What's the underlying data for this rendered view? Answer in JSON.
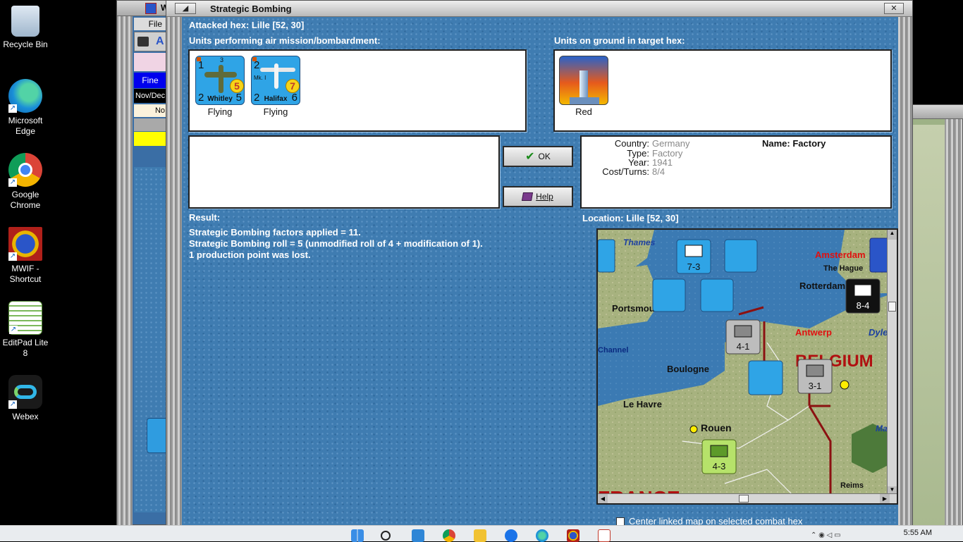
{
  "desktop": {
    "icons": [
      {
        "label": "Recycle Bin",
        "icon": "recycle-bin-icon"
      },
      {
        "label": "Microsoft Edge",
        "icon": "edge-icon"
      },
      {
        "label": "Google Chrome",
        "icon": "chrome-icon"
      },
      {
        "label": "MWIF - Shortcut",
        "icon": "mwif-icon"
      },
      {
        "label": "EditPad Lite 8",
        "icon": "editpad-icon"
      },
      {
        "label": "Webex",
        "icon": "webex-icon"
      }
    ]
  },
  "bg_window": {
    "title": "W",
    "menu_file": "File",
    "weather": "Fine",
    "turn": "Nov/Dec",
    "no": "No"
  },
  "dialog": {
    "title": "Strategic Bombing",
    "attacked_hex": "Attacked hex: Lille  [52, 30]",
    "air_units_label": "Units performing air mission/bombardment:",
    "ground_units_label": "Units on ground in target hex:",
    "air_units": [
      {
        "name": "Whitley",
        "status": "Flying",
        "top_left": "1",
        "top_mid": "3",
        "bottom_left": "2",
        "bottom_right": "5",
        "factor": "5"
      },
      {
        "name": "Halifax",
        "status": "Flying",
        "top_left": "2",
        "top_mid": "Mk. I",
        "bottom_left": "2",
        "bottom_right": "6",
        "factor": "7"
      }
    ],
    "ground_units": [
      {
        "name": "Red",
        "icon": "factory-icon"
      }
    ],
    "ok_label": "OK",
    "help_label": "Help",
    "info": {
      "country_key": "Country:",
      "country": "Germany",
      "type_key": "Type:",
      "type": "Factory",
      "year_key": "Year:",
      "year": "1941",
      "cost_key": "Cost/Turns:",
      "cost": "8/4",
      "name": "Name: Factory"
    },
    "result_label": "Result:",
    "result_lines": [
      "Strategic Bombing factors applied = 11.",
      "Strategic Bombing roll = 5 (unmodified roll of 4 + modification of 1).",
      "1 production point was lost."
    ],
    "location_label": "Location:  Lille  [52, 30]",
    "center_checkbox_label": "Center linked map on selected combat hex",
    "center_checked": false
  },
  "map": {
    "labels": [
      "Thames",
      "Amsterdam",
      "The Hague",
      "Rotterdam",
      "Portsmouth",
      "Antwerp",
      "Dyle",
      "Channel",
      "Boulogne",
      "BELGIUM",
      "Le Havre",
      "Rouen",
      "Maas",
      "Reims",
      "FRANCE"
    ],
    "counters": [
      "7-3",
      "8-4",
      "4-1",
      "3-1",
      "4-3"
    ]
  },
  "taskbar": {
    "time": "5:55 AM"
  }
}
